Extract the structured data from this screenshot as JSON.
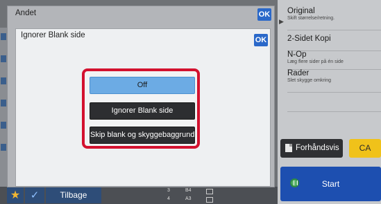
{
  "dialog": {
    "title": "Andet",
    "ok_label": "OK"
  },
  "subdialog": {
    "title": "Ignorer Blank side",
    "ok_label": "OK",
    "options": [
      {
        "label": "Off",
        "selected": true
      },
      {
        "label": "Ignorer Blank side",
        "selected": false
      },
      {
        "label": "Skip blank og skyggebaggrund",
        "selected": false
      }
    ]
  },
  "right_panel": {
    "items": [
      {
        "title": "Original",
        "subtitle": "Skift størrelse/retning."
      },
      {
        "title": "2-Sidet Kopi",
        "subtitle": ""
      },
      {
        "title": "N-Op",
        "subtitle": "Læg flere sider på én side"
      },
      {
        "title": "Rader",
        "subtitle": "Slet skygge omkring"
      }
    ],
    "preview_label": "Forhåndsvis",
    "ca_label": "CA",
    "start_label": "Start"
  },
  "bottom_bar": {
    "back_label": "Tilbage",
    "star_icon": "★",
    "check_icon": "✓",
    "trays": [
      {
        "number": "3",
        "size": "B4"
      },
      {
        "number": "4",
        "size": "A3"
      }
    ]
  },
  "colors": {
    "accent_blue": "#2a68c9",
    "selected_option": "#6cabe4",
    "highlight_frame": "#d3112f",
    "ca_button": "#f0c21a",
    "start_button": "#1d4fb0"
  }
}
